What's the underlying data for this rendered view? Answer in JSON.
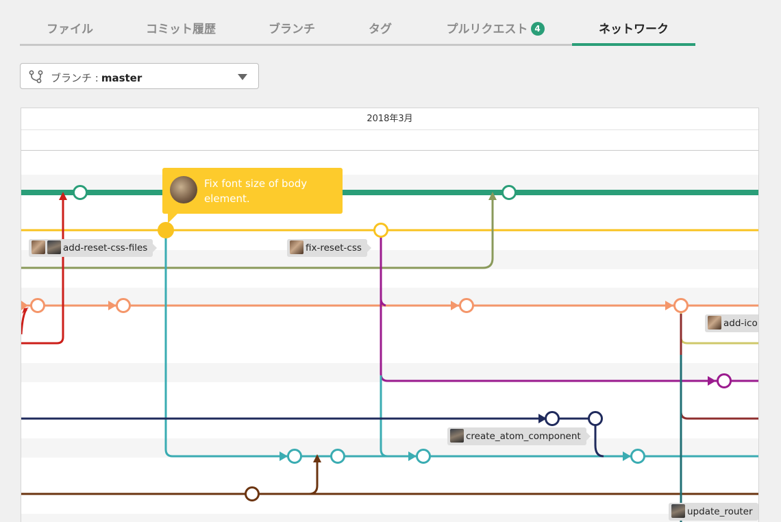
{
  "tabs": [
    {
      "label": "ファイル",
      "active": false
    },
    {
      "label": "コミット履歴",
      "active": false
    },
    {
      "label": "ブランチ",
      "active": false
    },
    {
      "label": "タグ",
      "active": false
    },
    {
      "label": "プルリクエスト",
      "badge": "4",
      "active": false
    },
    {
      "label": "ネットワーク",
      "active": true
    }
  ],
  "branch_selector": {
    "icon": "branch-icon",
    "prefix": "ブランチ :",
    "value": "master"
  },
  "graph": {
    "month_header": "2018年3月",
    "tooltip": {
      "text": "Fix font size of body element.",
      "color": "#fdcb2c"
    },
    "labels": [
      {
        "text": "add-reset-css-files"
      },
      {
        "text": "fix-reset-css"
      },
      {
        "text": "add-ico"
      },
      {
        "text": "create_atom_component"
      },
      {
        "text": "update_router"
      }
    ],
    "colors": {
      "master": "#2a9e78",
      "yellow": "#f9c320",
      "olive": "#8a9a5b",
      "salmon": "#f4966a",
      "red": "#cc1f1a",
      "teal": "#3aacb2",
      "purple": "#9b1b8e",
      "navy": "#1f2a5c",
      "brown": "#6b3410",
      "khaki": "#cfc86a",
      "maroon": "#8e2e2e",
      "darkteal": "#1f6f74"
    }
  },
  "accent": "#2a9e78"
}
